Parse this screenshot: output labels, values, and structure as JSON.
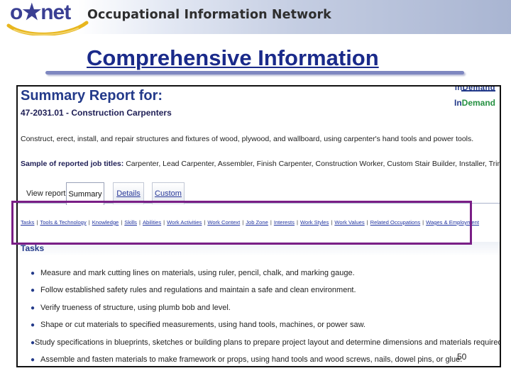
{
  "banner": {
    "logo_text": "o★net",
    "network_name": "Occupational Information Network"
  },
  "slide": {
    "title": "Comprehensive Information",
    "page_number": "50"
  },
  "report": {
    "title": "Summary Report for:",
    "occupation": "47-2031.01 - Construction Carpenters",
    "brand_top": "InDemand",
    "brand_in": "In",
    "brand_demand": "Demand",
    "description": "Construct, erect, install, and repair structures and fixtures of wood, plywood, and wallboard, using carpenter's hand tools and power tools.",
    "sample_label": "Sample of reported job titles:",
    "sample_titles": "Carpenter, Lead Carpenter, Assembler, Finish Carpenter, Construction Worker, Custom Stair Builder, Installer, Trim Carpenter",
    "view_label": "View report:",
    "tabs": [
      "Summary",
      "Details",
      "Custom"
    ],
    "active_tab": "Summary",
    "nav_links": [
      "Tasks",
      "Tools & Technology",
      "Knowledge",
      "Skills",
      "Abilities",
      "Work Activities",
      "Work Context",
      "Job Zone",
      "Interests",
      "Work Styles",
      "Work Values",
      "Related Occupations",
      "Wages & Employment"
    ],
    "tasks_heading": "Tasks",
    "tasks": [
      "Measure and mark cutting lines on materials, using ruler, pencil, chalk, and marking gauge.",
      "Follow established safety rules and regulations and maintain a safe and clean environment.",
      "Verify trueness of structure, using plumb bob and level.",
      "Shape or cut materials to specified measurements, using hand tools, machines, or power saw.",
      "Study specifications in blueprints, sketches or building plans to prepare project layout and determine dimensions and materials required.",
      "Assemble and fasten materials to make framework or props, using hand tools and wood screws, nails, dowel pins, or glue."
    ]
  }
}
